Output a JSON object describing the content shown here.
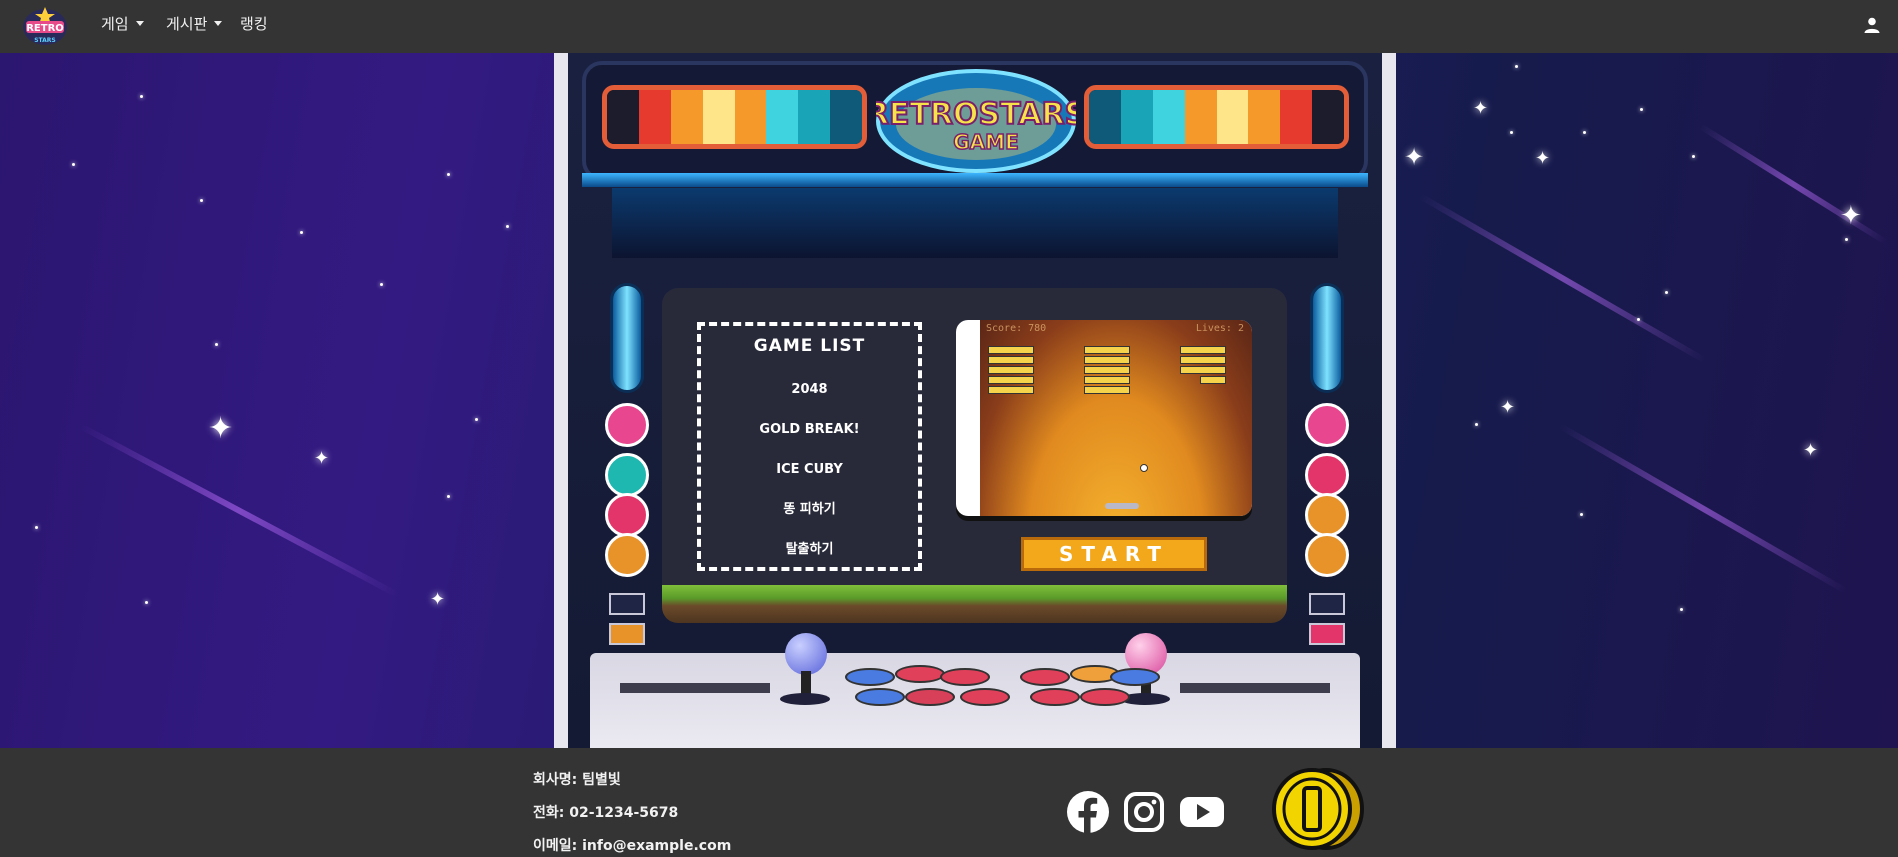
{
  "nav": {
    "menu": [
      {
        "label": "게임",
        "has_dropdown": true
      },
      {
        "label": "게시판",
        "has_dropdown": true
      },
      {
        "label": "랭킹",
        "has_dropdown": false
      }
    ],
    "logo_icon": "retro-stars-logo",
    "user_icon": "user-icon"
  },
  "arcade": {
    "game_list_title": "GAME LIST",
    "games": [
      "2048",
      "GOLD BREAK!",
      "ICE CUBY",
      "똥 피하기",
      "탈출하기"
    ],
    "preview": {
      "score_label": "Score: 780",
      "lives_label": "Lives: 2"
    },
    "start_label": "START"
  },
  "footer": {
    "company": "회사명: 팀별빛",
    "phone": "전화: 02-1234-5678",
    "email": "이메일: info@example.com",
    "social_icons": [
      "facebook-icon",
      "instagram-icon",
      "youtube-icon"
    ],
    "coin_icon": "gold-coin-icon"
  },
  "colors": {
    "navbar_bg": "#343434",
    "footer_bg": "#343434",
    "start_button": "#f3a81b",
    "screen_bg": "#282a3a"
  }
}
